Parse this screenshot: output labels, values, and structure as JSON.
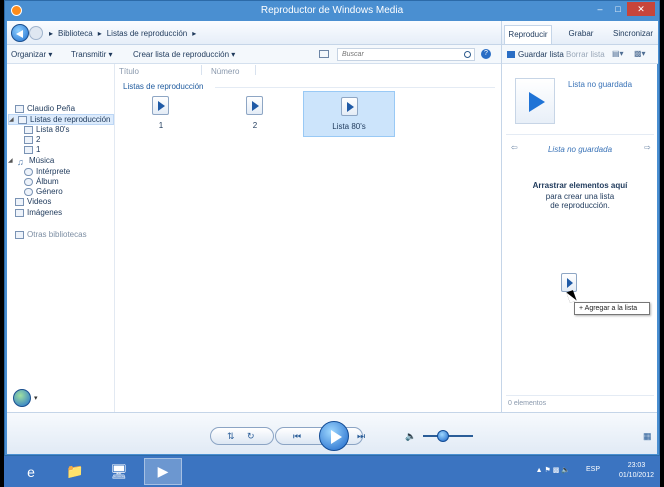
{
  "window": {
    "title": "Reproductor de Windows Media"
  },
  "nav": {
    "breadcrumb": [
      "Biblioteca",
      "Listas de reproducción"
    ]
  },
  "toolbar": {
    "organize": "Organizar",
    "stream": "Transmitir",
    "create_playlist": "Crear lista de reproducción",
    "search_placeholder": "Buscar"
  },
  "sidebar": {
    "user": "Claudio Peña",
    "playlists": "Listas de reproducción",
    "playlist_items": [
      "Lista 80's",
      "2",
      "1"
    ],
    "music": "Música",
    "music_items": [
      "Intérprete",
      "Álbum",
      "Género"
    ],
    "videos": "Videos",
    "images": "Imágenes",
    "other_libraries": "Otras bibliotecas"
  },
  "content": {
    "columns": [
      "Título",
      "Número"
    ],
    "group_label": "Listas de reproducción",
    "tiles": [
      "1",
      "2",
      "Lista 80's"
    ]
  },
  "right_panel": {
    "tabs": [
      "Reproducir",
      "Grabar",
      "Sincronizar"
    ],
    "save_list": "Guardar lista",
    "clear_list": "Borrar lista",
    "unsaved_list_top": "Lista no guardada",
    "unsaved_list_title": "Lista no guardada",
    "drag_title": "Arrastrar elementos aquí",
    "drag_subtitle": "para crear una lista de reproducción.",
    "tooltip": "+ Agregar a la lista",
    "item_count": "0 elementos"
  },
  "taskbar": {
    "language": "ESP",
    "time": "23:03",
    "date": "01/10/2012"
  }
}
